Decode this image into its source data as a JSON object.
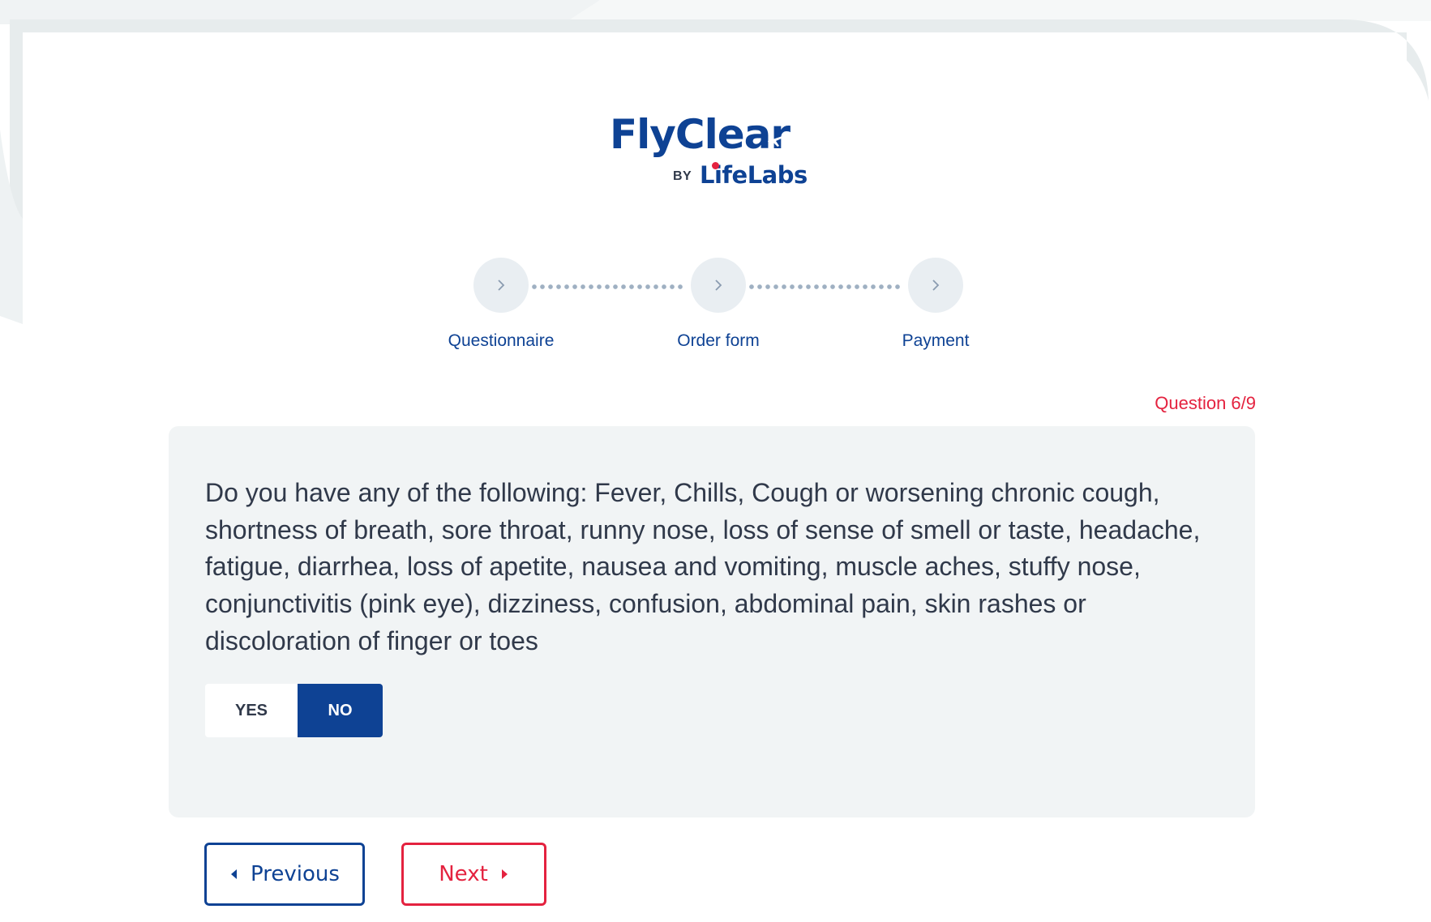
{
  "brand": {
    "name": "FlyClear",
    "by": "BY",
    "partner": "LifeLabs"
  },
  "steps": [
    {
      "label": "Questionnaire",
      "icon": "chevron-right-icon"
    },
    {
      "label": "Order form",
      "icon": "chevron-right-icon"
    },
    {
      "label": "Payment",
      "icon": "chevron-right-icon"
    }
  ],
  "question": {
    "counter": "Question 6/9",
    "text": "Do you have any of the following: Fever, Chills, Cough or worsening chronic cough, shortness of breath, sore throat, runny nose, loss of sense of smell or taste, headache, fatigue, diarrhea, loss of apetite, nausea and vomiting, muscle aches, stuffy nose, conjunctivitis (pink eye), dizziness, confusion, abdominal pain, skin rashes or discoloration of finger or toes",
    "options": {
      "yes_label": "YES",
      "no_label": "NO",
      "selected": "NO"
    }
  },
  "navigation": {
    "previous_label": "Previous",
    "next_label": "Next"
  },
  "colors": {
    "brand_blue": "#0e4294",
    "accent_red": "#e4223f",
    "text_dark": "#30394a",
    "panel_bg": "#f1f4f5",
    "step_circle": "#e9eef2"
  }
}
